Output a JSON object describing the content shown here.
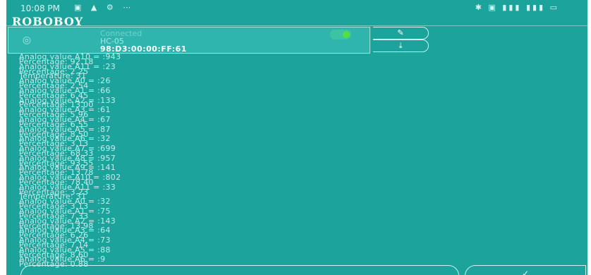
{
  "status_bar": {
    "time": "10:08 PM",
    "left_icons": "▣ ▲ ⚙ ⋯",
    "right_icons": "✱ ▣ ▮▮▮ ▮▮▮ ▭"
  },
  "app": {
    "title": "ROBOBOY"
  },
  "device": {
    "icon": "bluetooth-device-icon",
    "status": "Connected",
    "name": "HC-05",
    "mac": "98:D3:00:00:FF:61",
    "icon_glyph": "◎"
  },
  "actions": {
    "top_glyph": "✎",
    "bottom_glyph": "⤓"
  },
  "log": [
    "Analog value A10 = :943",
    "Percentage: 92.18",
    "Analog value A11 = :23",
    "Percentage: 2.25",
    "Temperature: 31",
    "Analog value A0 = :26",
    "Percentage: 2.54",
    "Analog value A1 = :66",
    "Percentage: 6.45",
    "Analog value A2 = :133",
    "Percentage: 13.00",
    "Analog value A3 = :61",
    "Percentage: 5.96",
    "Analog value A4 = :67",
    "Percentage: 6.55",
    "Analog value A5 = :87",
    "Percentage: 8.50",
    "Analog value A6 = :32",
    "Percentage: 3.13",
    "Analog value A7 = :699",
    "Percentage: 68.33",
    "Analog value A8 = :957",
    "Percentage: 93.55",
    "Analog value A9 = :141",
    "Percentage: 13.78",
    "Analog value A10 = :802",
    "Percentage: 78.40",
    "Analog value A11 = :33",
    "Percentage: 3.23",
    "Temperature: 31",
    "Analog value A0 = :32",
    "Percentage: 3.13",
    "Analog value A1 = :75",
    "Percentage: 7.33",
    "Analog value A2 = :143",
    "Percentage: 13.98",
    "Analog value A3 = :64",
    "Percentage: 6.26",
    "Analog value A4 = :73",
    "Percentage: 7.14",
    "Analog value A5 = :88",
    "Percentage: 8.60",
    "Analog value A6 = :9",
    "Percentage: 0.88"
  ],
  "bottom": {
    "send_glyph": "✓"
  }
}
